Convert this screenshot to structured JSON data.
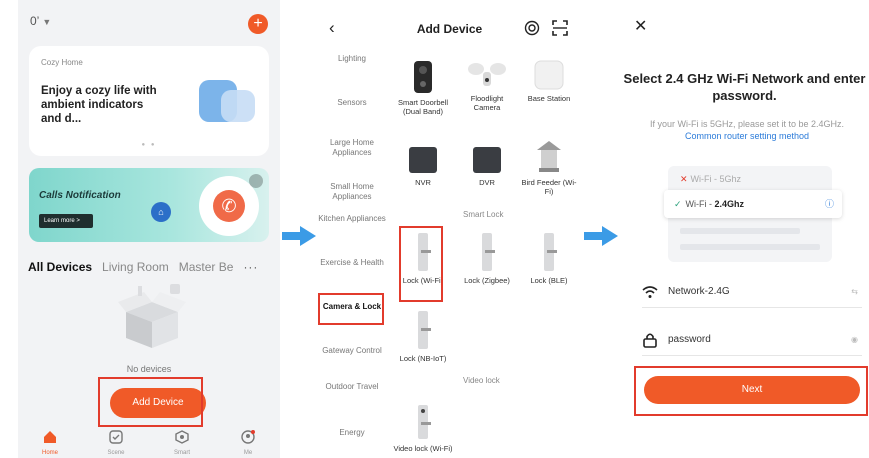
{
  "screen1": {
    "home_name": "0’",
    "cozy_card": {
      "small_label": "Cozy Home",
      "headline": "Enjoy a cozy life with ambient indicators and d..."
    },
    "calls_card": {
      "title": "Calls Notification",
      "button": "Learn more >"
    },
    "tabs": [
      "All Devices",
      "Living Room",
      "Master Be"
    ],
    "tabs_more": "···",
    "empty_text": "No devices",
    "add_device": "Add Device",
    "nav": [
      "Home",
      "Scene",
      "Smart",
      "Me"
    ]
  },
  "screen2": {
    "title": "Add Device",
    "categories": [
      "Lighting",
      "Sensors",
      "Large Home Appliances",
      "Small Home Appliances",
      "Kitchen Appliances",
      "Exercise & Health",
      "Camera & Lock",
      "Gateway Control",
      "Outdoor Travel",
      "Energy"
    ],
    "devices": [
      "Smart Doorbell (Dual Band)",
      "Floodlight Camera",
      "Base Station",
      "NVR",
      "DVR",
      "Bird Feeder (Wi-Fi)",
      "Lock (Wi-Fi)",
      "Lock (Zigbee)",
      "Lock (BLE)",
      "Lock (NB-IoT)",
      "Video lock (Wi-Fi)"
    ],
    "sections": {
      "smart_lock": "Smart Lock",
      "video_lock": "Video lock"
    }
  },
  "screen3": {
    "close": "✕",
    "title": "Select 2.4 GHz Wi-Fi Network and enter password.",
    "hint": "If your Wi-Fi is 5GHz, please set it to be 2.4GHz.",
    "hint_link": "Common router setting method",
    "wifi_5g": "Wi-Fi - 5Ghz",
    "wifi_24_prefix": "Wi-Fi - ",
    "wifi_24_band": "2.4Ghz",
    "ssid_value": "Network-2.4G",
    "password_value": "password",
    "next": "Next"
  },
  "colors": {
    "accent": "#f05a28",
    "highlight": "#e23b2c",
    "arrow": "#3b9be6",
    "link": "#2b7bd9"
  }
}
